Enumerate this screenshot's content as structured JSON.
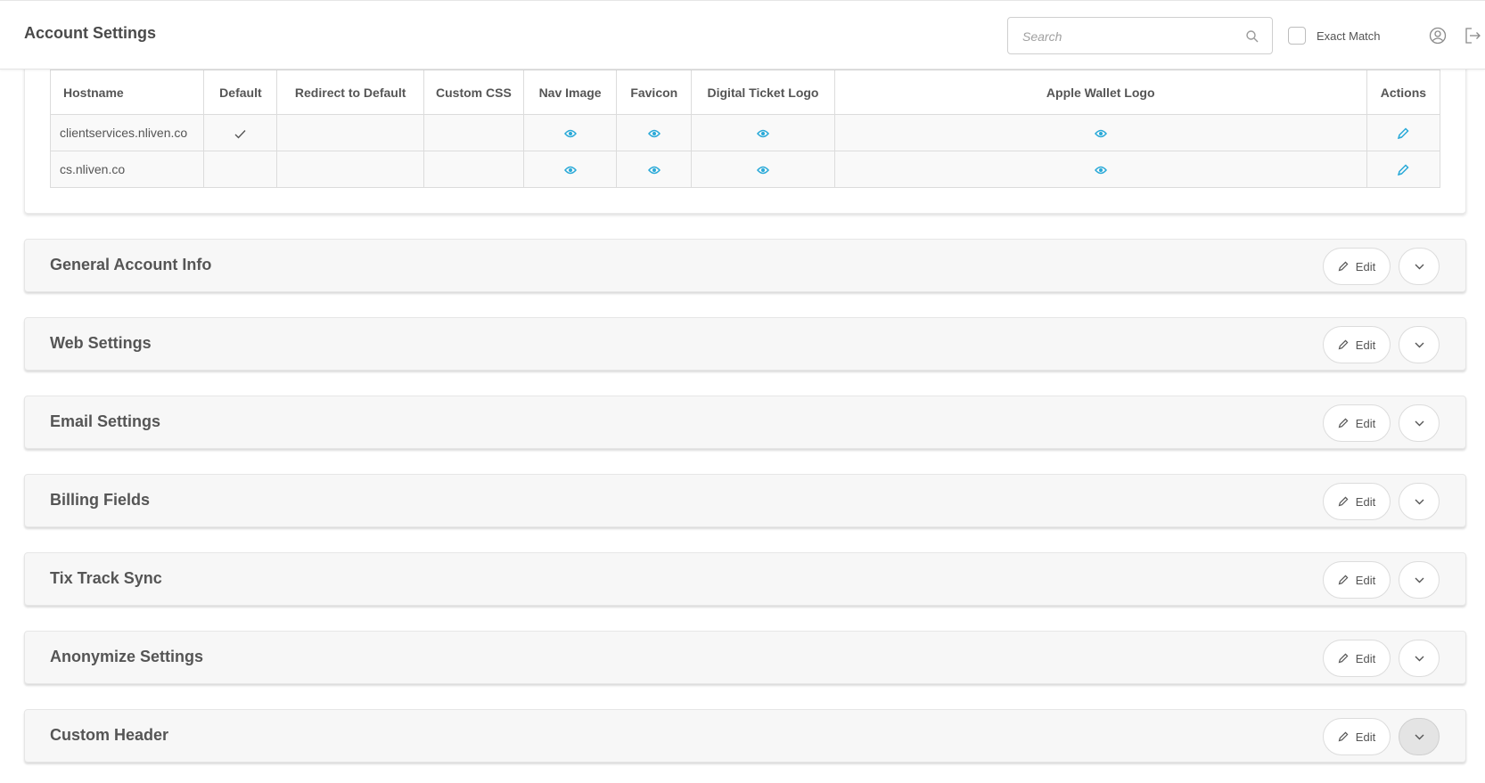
{
  "header": {
    "title": "Account Settings",
    "search_placeholder": "Search",
    "search_value": "",
    "exact_match_label": "Exact Match",
    "exact_match_checked": false
  },
  "hostnames_table": {
    "columns": [
      "Hostname",
      "Default",
      "Redirect to Default",
      "Custom CSS",
      "Nav Image",
      "Favicon",
      "Digital Ticket Logo",
      "Apple Wallet Logo",
      "Actions"
    ],
    "rows": [
      {
        "hostname": "clientservices.nliven.co",
        "default": true,
        "redirect_to_default": false,
        "custom_css": "",
        "nav_image": "view-icon",
        "favicon": "view-icon",
        "digital_ticket_logo": "view-icon",
        "apple_wallet_logo": "view-icon",
        "actions": "edit-icon"
      },
      {
        "hostname": "cs.nliven.co",
        "default": false,
        "redirect_to_default": false,
        "custom_css": "",
        "nav_image": "view-icon",
        "favicon": "view-icon",
        "digital_ticket_logo": "view-icon",
        "apple_wallet_logo": "view-icon",
        "actions": "edit-icon"
      }
    ]
  },
  "sections": [
    {
      "title": "General Account Info",
      "edit_label": "Edit",
      "expanded": false
    },
    {
      "title": "Web Settings",
      "edit_label": "Edit",
      "expanded": false
    },
    {
      "title": "Email Settings",
      "edit_label": "Edit",
      "expanded": false
    },
    {
      "title": "Billing Fields",
      "edit_label": "Edit",
      "expanded": false
    },
    {
      "title": "Tix Track Sync",
      "edit_label": "Edit",
      "expanded": false
    },
    {
      "title": "Anonymize Settings",
      "edit_label": "Edit",
      "expanded": false
    },
    {
      "title": "Custom Header",
      "edit_label": "Edit",
      "expanded": false,
      "toggle_hovered": true
    }
  ],
  "colors": {
    "accent": "#29a9d8",
    "panel_bg": "#f7f7f7",
    "border": "#dcdcdc",
    "text": "#555555"
  }
}
